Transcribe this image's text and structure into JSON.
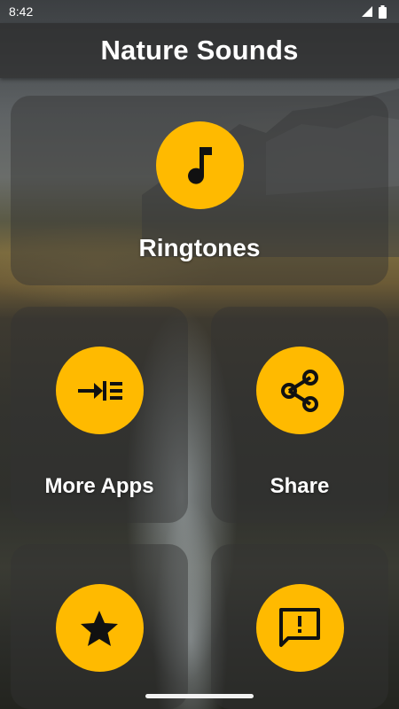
{
  "status_bar": {
    "time": "8:42",
    "icons": [
      "signal-icon",
      "battery-icon"
    ]
  },
  "app_bar": {
    "title": "Nature Sounds"
  },
  "cards": {
    "ringtones": {
      "label": "Ringtones",
      "icon": "music-note-icon"
    },
    "more_apps": {
      "label": "More Apps",
      "icon": "more-apps-icon"
    },
    "share": {
      "label": "Share",
      "icon": "share-icon"
    },
    "rate": {
      "label": "",
      "icon": "star-icon"
    },
    "feedback": {
      "label": "",
      "icon": "feedback-icon"
    }
  },
  "colors": {
    "accent": "#ffba00",
    "icon": "#111111",
    "app_bar": "#2d2d2d",
    "card": "#323232"
  }
}
